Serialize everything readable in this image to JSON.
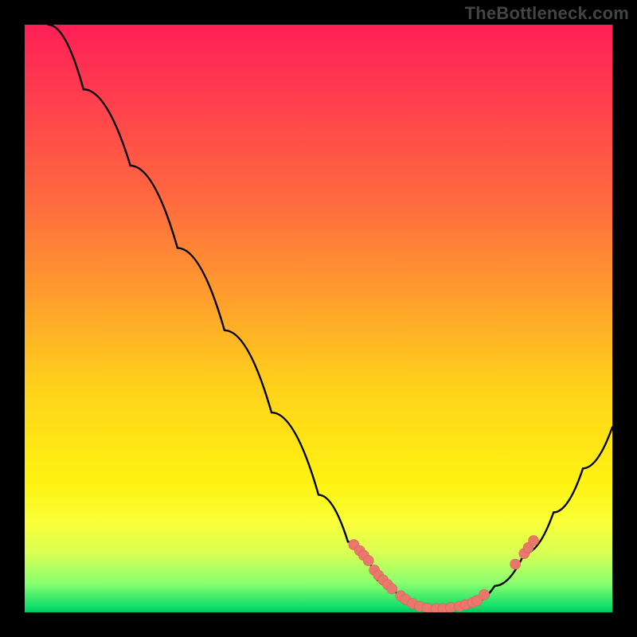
{
  "attribution": "TheBottleneck.com",
  "chart_data": {
    "type": "line",
    "title": "",
    "xlabel": "",
    "ylabel": "",
    "x_range": [
      0,
      1
    ],
    "y_range": [
      0,
      1
    ],
    "curve": [
      {
        "x": 0.04,
        "y": 1.0
      },
      {
        "x": 0.1,
        "y": 0.89
      },
      {
        "x": 0.18,
        "y": 0.76
      },
      {
        "x": 0.26,
        "y": 0.62
      },
      {
        "x": 0.34,
        "y": 0.48
      },
      {
        "x": 0.42,
        "y": 0.34
      },
      {
        "x": 0.5,
        "y": 0.2
      },
      {
        "x": 0.55,
        "y": 0.12
      },
      {
        "x": 0.6,
        "y": 0.055
      },
      {
        "x": 0.64,
        "y": 0.022
      },
      {
        "x": 0.68,
        "y": 0.008
      },
      {
        "x": 0.72,
        "y": 0.005
      },
      {
        "x": 0.76,
        "y": 0.015
      },
      {
        "x": 0.8,
        "y": 0.045
      },
      {
        "x": 0.85,
        "y": 0.1
      },
      {
        "x": 0.9,
        "y": 0.17
      },
      {
        "x": 0.95,
        "y": 0.245
      },
      {
        "x": 1.0,
        "y": 0.315
      }
    ],
    "points": [
      {
        "x": 0.56,
        "y": 0.115
      },
      {
        "x": 0.57,
        "y": 0.105
      },
      {
        "x": 0.577,
        "y": 0.097
      },
      {
        "x": 0.585,
        "y": 0.088
      },
      {
        "x": 0.595,
        "y": 0.072
      },
      {
        "x": 0.602,
        "y": 0.063
      },
      {
        "x": 0.61,
        "y": 0.055
      },
      {
        "x": 0.618,
        "y": 0.047
      },
      {
        "x": 0.625,
        "y": 0.04
      },
      {
        "x": 0.64,
        "y": 0.028
      },
      {
        "x": 0.648,
        "y": 0.022
      },
      {
        "x": 0.66,
        "y": 0.015
      },
      {
        "x": 0.835,
        "y": 0.082
      },
      {
        "x": 0.85,
        "y": 0.1
      },
      {
        "x": 0.857,
        "y": 0.11
      },
      {
        "x": 0.866,
        "y": 0.122
      },
      {
        "x": 0.672,
        "y": 0.01
      },
      {
        "x": 0.685,
        "y": 0.007
      },
      {
        "x": 0.7,
        "y": 0.006
      },
      {
        "x": 0.712,
        "y": 0.006
      },
      {
        "x": 0.725,
        "y": 0.008
      },
      {
        "x": 0.74,
        "y": 0.01
      },
      {
        "x": 0.75,
        "y": 0.013
      },
      {
        "x": 0.762,
        "y": 0.017
      },
      {
        "x": 0.77,
        "y": 0.02
      },
      {
        "x": 0.782,
        "y": 0.03
      }
    ]
  }
}
